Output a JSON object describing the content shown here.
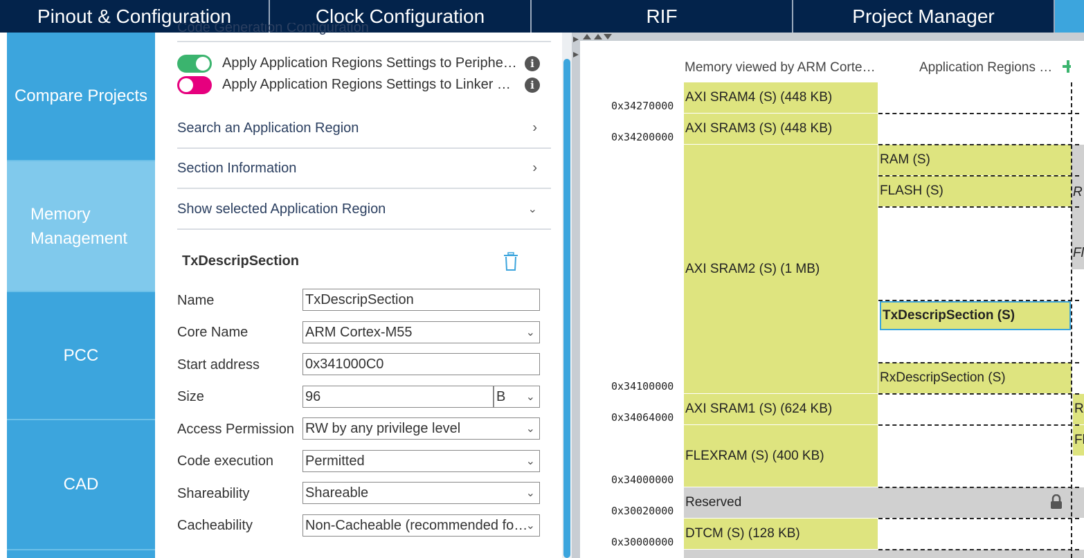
{
  "top_tabs": [
    "Pinout & Configuration",
    "Clock Configuration",
    "RIF",
    "Project Manager"
  ],
  "left_nav": [
    "Compare Projects",
    "Memory Management",
    "PCC",
    "CAD"
  ],
  "mid": {
    "partial_header": "Code Generation Configuration",
    "toggles": [
      {
        "label": "Apply Application Regions Settings to Periphe…",
        "state": "on",
        "color": "#3bb46e"
      },
      {
        "label": "Apply Application Regions Settings to Linker …",
        "state": "off",
        "color": "#e6007e"
      }
    ],
    "sections": [
      {
        "label": "Search an Application Region",
        "chevron": ">"
      },
      {
        "label": "Section Information",
        "chevron": ">"
      },
      {
        "label": "Show selected Application Region",
        "chevron": "v"
      }
    ],
    "selected_region": {
      "title": "TxDescripSection",
      "fields": [
        {
          "label": "Name",
          "value": "TxDescripSection",
          "type": "text"
        },
        {
          "label": "Core Name",
          "value": "ARM Cortex-M55",
          "type": "select"
        },
        {
          "label": "Start address",
          "value": "0x341000C0",
          "type": "text"
        },
        {
          "label": "Size",
          "value": "96",
          "unit": "B",
          "type": "text+unit"
        },
        {
          "label": "Access Permission",
          "value": "RW by any privilege level",
          "type": "select"
        },
        {
          "label": "Code execution",
          "value": "Permitted",
          "type": "select"
        },
        {
          "label": "Shareability",
          "value": "Shareable",
          "type": "select"
        },
        {
          "label": "Cacheability",
          "value": "Non-Cacheable (recommended fo…",
          "type": "select"
        }
      ]
    }
  },
  "map": {
    "col_headers": [
      "Memory viewed by ARM Corte…",
      "Application Regions …"
    ],
    "addresses": [
      "0x34270000",
      "0x34200000",
      "0x34100000",
      "0x34064000",
      "0x34000000",
      "0x30020000",
      "0x30000000"
    ],
    "memory_blocks": [
      "AXI SRAM4 (S) (448 KB)",
      "AXI SRAM3 (S) (448 KB)",
      "AXI SRAM2 (S) (1 MB)",
      "AXI SRAM1 (S) (624 KB)",
      "FLEXRAM (S) (400 KB)",
      "Reserved",
      "DTCM (S) (128 KB)"
    ],
    "regions": [
      "RAM (S)",
      "FLASH (S)",
      "TxDescripSection (S)",
      "RxDescripSection (S)"
    ],
    "edge_letters": [
      "R",
      "Fl",
      "R",
      "Fl"
    ],
    "colors": {
      "block": "#dee47f",
      "reserved": "#d0d0d0",
      "selected_border": "#3ca5dd",
      "nav": "#3ca5dd",
      "topbar": "#03234b"
    }
  }
}
